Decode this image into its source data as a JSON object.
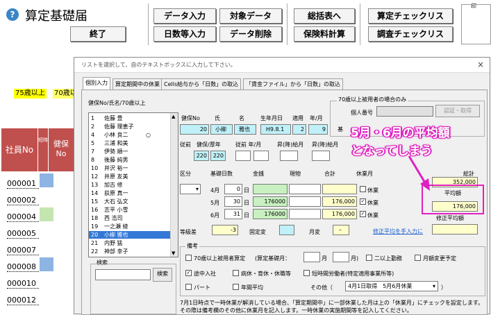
{
  "header": {
    "title": "算定基礎届",
    "help_icon": "?",
    "buttons": {
      "end": "終了",
      "data_input": "データ入力",
      "target_data": "対象データ",
      "summary": "総括表へ",
      "calc_check": "算定チェックリス",
      "days_input": "日数等入力",
      "data_delete": "データ削除",
      "insurance_calc": "保険料計算",
      "survey_check": "調査チェックリス"
    },
    "print_label": "印"
  },
  "sheet": {
    "age75": "75歳以上",
    "age70": "70歳以",
    "col_no": "社員No",
    "col_cut1": "短時",
    "col_cut2": "健保No",
    "rows": [
      "000001",
      "000002",
      "000004",
      "000005",
      "000007",
      "000008",
      "000010",
      "000012"
    ]
  },
  "dialog": {
    "caption": "リストを選択して、自のテキストボックスに入力して下さい。",
    "close": "×",
    "tabs": [
      "個別入力",
      "算定期間中の休業",
      "Cells給与から「日数」の取込",
      "「賃金ファイル」から「日数」の取込"
    ],
    "list_title": "健保No/氏名/70歳以上",
    "list": [
      [
        "1",
        "佐藤 豊",
        ""
      ],
      [
        "2",
        "佐藤 理恵子",
        ""
      ],
      [
        "4",
        "小林 良二",
        "○"
      ],
      [
        "5",
        "三浦 和美",
        ""
      ],
      [
        "7",
        "伊勢 順一",
        ""
      ],
      [
        "8",
        "後藤 純男",
        ""
      ],
      [
        "10",
        "井沢 裕一",
        ""
      ],
      [
        "12",
        "井原 友美",
        ""
      ],
      [
        "13",
        "加古 修",
        ""
      ],
      [
        "14",
        "荻原 真一",
        ""
      ],
      [
        "15",
        "大石 弘文",
        ""
      ],
      [
        "16",
        "志平 小雪",
        ""
      ],
      [
        "18",
        "西 浩司",
        ""
      ],
      [
        "19",
        "一之瀬 綾",
        ""
      ],
      [
        "20",
        "小柳 雅也",
        ""
      ],
      [
        "21",
        "内野 猛",
        ""
      ],
      [
        "22",
        "神部 幸子",
        ""
      ]
    ],
    "search_label": "検索",
    "search_btn": "検索",
    "over70_group": "70歳以上被用者の場合のみ",
    "personal_no": "個人番号",
    "confirm_btn": "認証・取得",
    "fields": {
      "kenpo_no": "健保No",
      "shi": "氏",
      "mei": "名",
      "birth": "生年月日",
      "apply": "適用",
      "ym": "年/月",
      "kenpo_v": "20",
      "shi_v": "小柳",
      "mei_v": "雅也",
      "birth_v": "H9.8.1",
      "apply_v": "2",
      "month_v": "9",
      "prev": "従前",
      "prev_kp": "健保/厚年",
      "prev_ym": "従前 年/月",
      "promo": "昇(降)給月",
      "promo2": "昇(降)給月",
      "kp1": "220",
      "kp2": "220",
      "base_label": "基"
    },
    "table": {
      "kubun": "区分",
      "days": "基礎日数",
      "money": "金銭",
      "goods": "現物",
      "total": "合計",
      "leave": "休業月",
      "rows": [
        {
          "m": "4",
          "d": "0",
          "mon": "",
          "sum": "",
          "chk": ""
        },
        {
          "m": "5",
          "d": "30",
          "mon": "176000",
          "sum": "176,000",
          "chk": "✓"
        },
        {
          "m": "6",
          "d": "31",
          "mon": "176000",
          "sum": "176,000",
          "chk": "✓"
        }
      ],
      "month_unit": "月",
      "day_unit": "日",
      "leave_label": "休業"
    },
    "right": {
      "total_label": "総計",
      "total_v": "352,000",
      "avg_label": "平均額",
      "avg_v": "176,000",
      "avg_fix": "修正平均額"
    },
    "grade": {
      "label": "等級差",
      "v": "-3",
      "fixed": "固定変",
      "monthly": "月変",
      "monthly_v": "–",
      "link": "修正平均を手入力に"
    },
    "remarks": {
      "title": "備考",
      "over70": "70歳以上被用者算定",
      "calc_month": "(算定基礎月：",
      "m_unit": "月",
      "m_close": "月)",
      "multi": "二以上勤務",
      "change": "月額変更予定",
      "midjoin": "途中入社",
      "sick": "病休・育休・休職等",
      "shorttime": "短時間労働者(特定適用事業所等)",
      "part": "パート",
      "annual": "年間平均",
      "other": "その他（",
      "other_v": "4月1日取得　5月6月休業",
      "close_paren": "）"
    },
    "note": "7月1日時点で一時休業が解消している場合、「算定期間中」に一部休業した月は上の「休業月」にチェックを設定します。その際は備考欄のその他に休業月を記入します。一時休業の実施期間等を記入してください。"
  },
  "callout": {
    "line1": "5月・6月の平均額",
    "line2": "となってしまう"
  },
  "colors": {
    "accent": "#e020c0",
    "header_red": "#c0504d",
    "cyan": "#c0f0f8"
  }
}
